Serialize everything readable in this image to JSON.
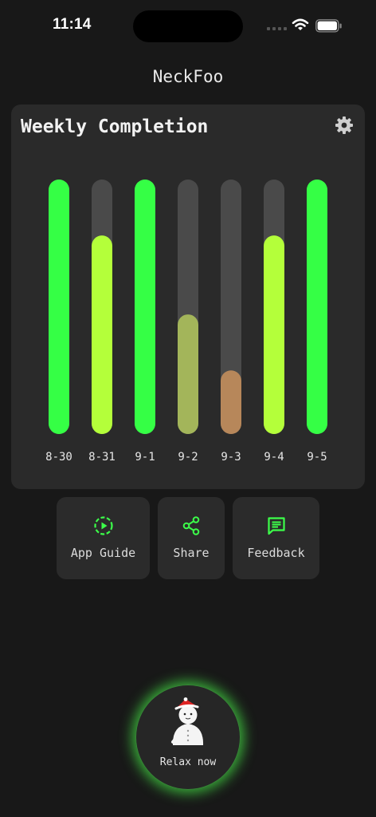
{
  "status_bar": {
    "time": "11:14"
  },
  "app": {
    "title": "NeckFoo"
  },
  "card": {
    "title": "Weekly Completion"
  },
  "chart_data": {
    "type": "bar",
    "categories": [
      "8-30",
      "8-31",
      "9-1",
      "9-2",
      "9-3",
      "9-4",
      "9-5"
    ],
    "values": [
      1.0,
      0.78,
      1.0,
      0.47,
      0.25,
      0.78,
      1.0
    ],
    "colors": [
      "#35ff45",
      "#b4ff3a",
      "#35ff45",
      "#a3b55a",
      "#b7875a",
      "#b4ff3a",
      "#35ff45"
    ],
    "track_color": "#4a4a4a",
    "ylim": [
      0,
      1
    ]
  },
  "actions": [
    {
      "label": "App Guide",
      "icon": "play-circle-icon"
    },
    {
      "label": "Share",
      "icon": "share-icon"
    },
    {
      "label": "Feedback",
      "icon": "message-icon"
    }
  ],
  "relax": {
    "label": "Relax now",
    "icon": "snowman-mascot-icon"
  },
  "colors": {
    "accent": "#3cff4a",
    "background": "#181818",
    "card": "#2a2a2a"
  }
}
